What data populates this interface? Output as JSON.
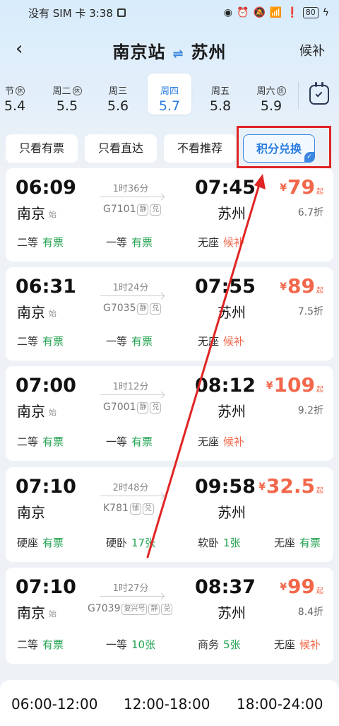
{
  "status": {
    "left": "没有 SIM 卡 3:38",
    "battery": "80"
  },
  "header": {
    "from": "南京站",
    "to": "苏州",
    "houbu": "候补"
  },
  "dates": [
    {
      "weekday": "节",
      "date": "5.4",
      "tag": "休"
    },
    {
      "weekday": "周二",
      "date": "5.5",
      "tag": "休"
    },
    {
      "weekday": "周三",
      "date": "5.6",
      "tag": ""
    },
    {
      "weekday": "周四",
      "date": "5.7",
      "tag": ""
    },
    {
      "weekday": "周五",
      "date": "5.8",
      "tag": ""
    },
    {
      "weekday": "周六",
      "date": "5.9",
      "tag": "班"
    }
  ],
  "filters": [
    "只看有票",
    "只看直达",
    "不看推荐",
    "积分兑换"
  ],
  "trains": [
    {
      "dep": "06:09",
      "arr": "07:45",
      "from": "南京",
      "start": "始",
      "to": "苏州",
      "duration": "1时36分",
      "code": "G7101",
      "badges": [
        "静",
        "兑"
      ],
      "price": "79",
      "yen": "¥",
      "qi": "起",
      "discount": "6.7折",
      "seats": [
        {
          "name": "二等",
          "status": "有票",
          "kind": "ok"
        },
        {
          "name": "一等",
          "status": "有票",
          "kind": "ok"
        },
        {
          "name": "无座",
          "status": "候补",
          "kind": "wait"
        }
      ]
    },
    {
      "dep": "06:31",
      "arr": "07:55",
      "from": "南京",
      "start": "始",
      "to": "苏州",
      "duration": "1时24分",
      "code": "G7035",
      "badges": [
        "静",
        "兑"
      ],
      "price": "89",
      "yen": "¥",
      "qi": "起",
      "discount": "7.5折",
      "seats": [
        {
          "name": "二等",
          "status": "有票",
          "kind": "ok"
        },
        {
          "name": "一等",
          "status": "有票",
          "kind": "ok"
        },
        {
          "name": "无座",
          "status": "候补",
          "kind": "wait"
        }
      ]
    },
    {
      "dep": "07:00",
      "arr": "08:12",
      "from": "南京",
      "start": "始",
      "to": "苏州",
      "duration": "1时12分",
      "code": "G7001",
      "badges": [
        "静",
        "兑"
      ],
      "price": "109",
      "yen": "¥",
      "qi": "起",
      "discount": "9.2折",
      "seats": [
        {
          "name": "二等",
          "status": "有票",
          "kind": "ok"
        },
        {
          "name": "一等",
          "status": "有票",
          "kind": "ok"
        },
        {
          "name": "无座",
          "status": "候补",
          "kind": "wait"
        }
      ]
    },
    {
      "dep": "07:10",
      "arr": "09:58",
      "from": "南京",
      "start": "",
      "to": "苏州",
      "duration": "2时48分",
      "code": "K781",
      "badges": [
        "铺",
        "兑"
      ],
      "price": "32.5",
      "yen": "¥",
      "qi": "起",
      "discount": "",
      "seats": [
        {
          "name": "硬座",
          "status": "有票",
          "kind": "ok"
        },
        {
          "name": "硬卧",
          "status": "17张",
          "kind": "ok"
        },
        {
          "name": "软卧",
          "status": "1张",
          "kind": "ok"
        },
        {
          "name": "无座",
          "status": "有票",
          "kind": "ok"
        }
      ]
    },
    {
      "dep": "07:10",
      "arr": "08:37",
      "from": "南京",
      "start": "始",
      "to": "苏州",
      "duration": "1时27分",
      "code": "G7039",
      "badges": [
        "复兴号",
        "静",
        "兑"
      ],
      "price": "99",
      "yen": "¥",
      "qi": "起",
      "discount": "8.4折",
      "seats": [
        {
          "name": "二等",
          "status": "有票",
          "kind": "ok"
        },
        {
          "name": "一等",
          "status": "10张",
          "kind": "ok"
        },
        {
          "name": "商务",
          "status": "5张",
          "kind": "ok"
        },
        {
          "name": "无座",
          "status": "候补",
          "kind": "wait"
        }
      ]
    }
  ],
  "time_slots": [
    "06:00-12:00",
    "12:00-18:00",
    "18:00-24:00"
  ],
  "colors": {
    "accent": "#2a7de1",
    "price": "#f2674a",
    "ok": "#22a350",
    "annotation": "#e02424"
  }
}
